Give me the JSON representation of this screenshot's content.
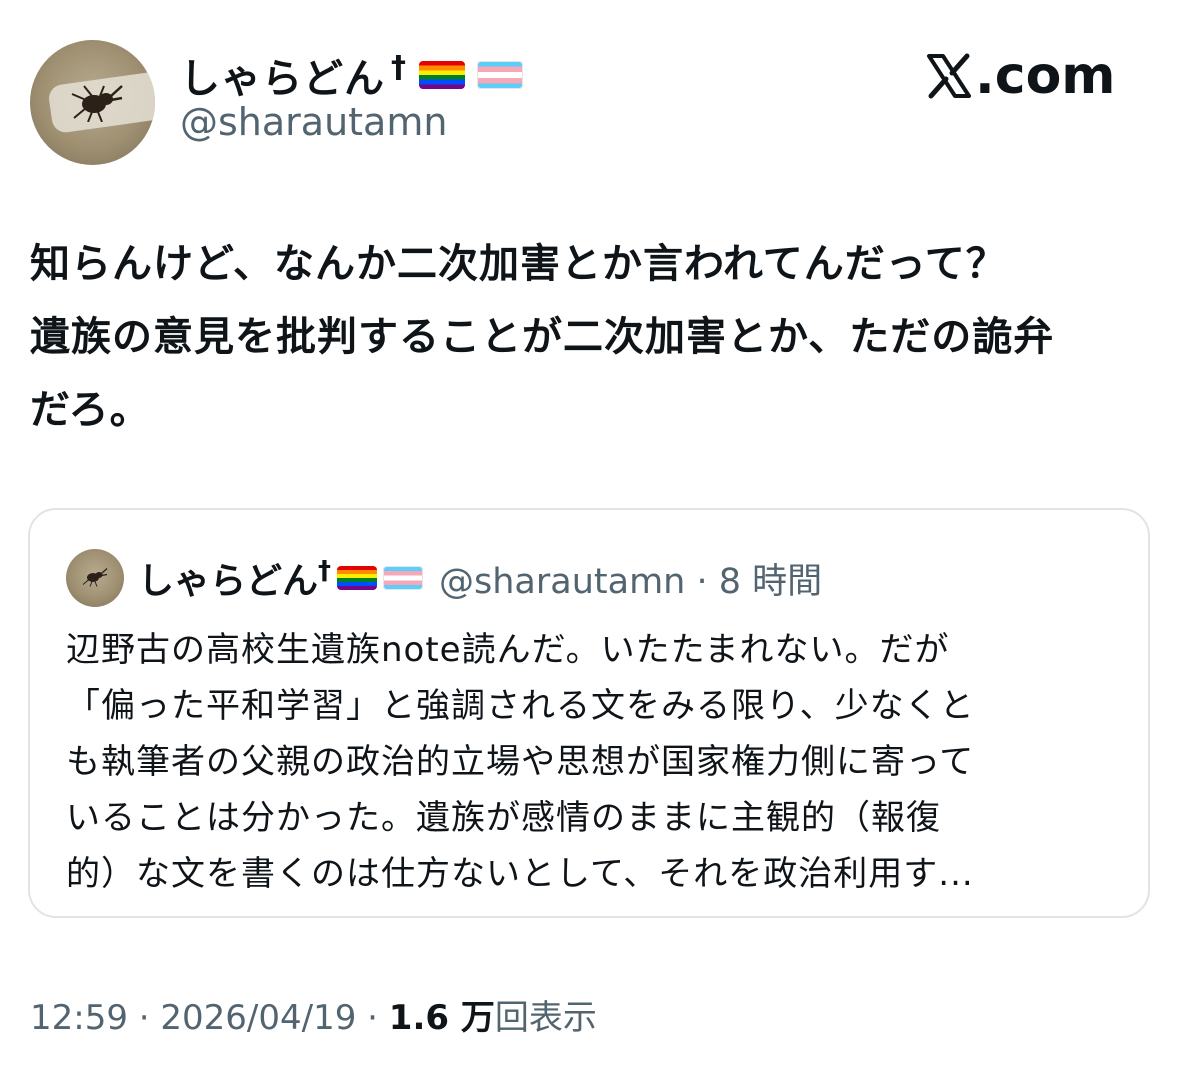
{
  "author": {
    "display_name": "しゃらどん",
    "dagger": "†",
    "flags": [
      "rainbow-flag-icon",
      "transgender-flag-icon"
    ],
    "handle": "@sharautamn"
  },
  "brand": {
    "label": ".com"
  },
  "tweet": {
    "lines": [
      "知らんけど、なんか二次加害とか言われてんだって？",
      "遺族の意見を批判することが二次加害とか、ただの詭弁",
      "だろ。"
    ]
  },
  "quote": {
    "display_name": "しゃらどん",
    "dagger": "†",
    "handle_time": "@sharautamn · 8 時間",
    "lines": [
      "辺野古の高校生遺族note読んだ。いたたまれない。だが",
      "「偏った平和学習」と強調される文をみる限り、少なくと",
      "も執筆者の父親の政治的立場や思想が国家権力側に寄って",
      "いることは分かった。遺族が感情のままに主観的（報復",
      "的）な文を書くのは仕方ないとして、それを政治利用す..."
    ]
  },
  "footer": {
    "time_date": "12:59 · 2026/04/19 · ",
    "views_count": "1.6 万",
    "views_label": "回表示"
  }
}
